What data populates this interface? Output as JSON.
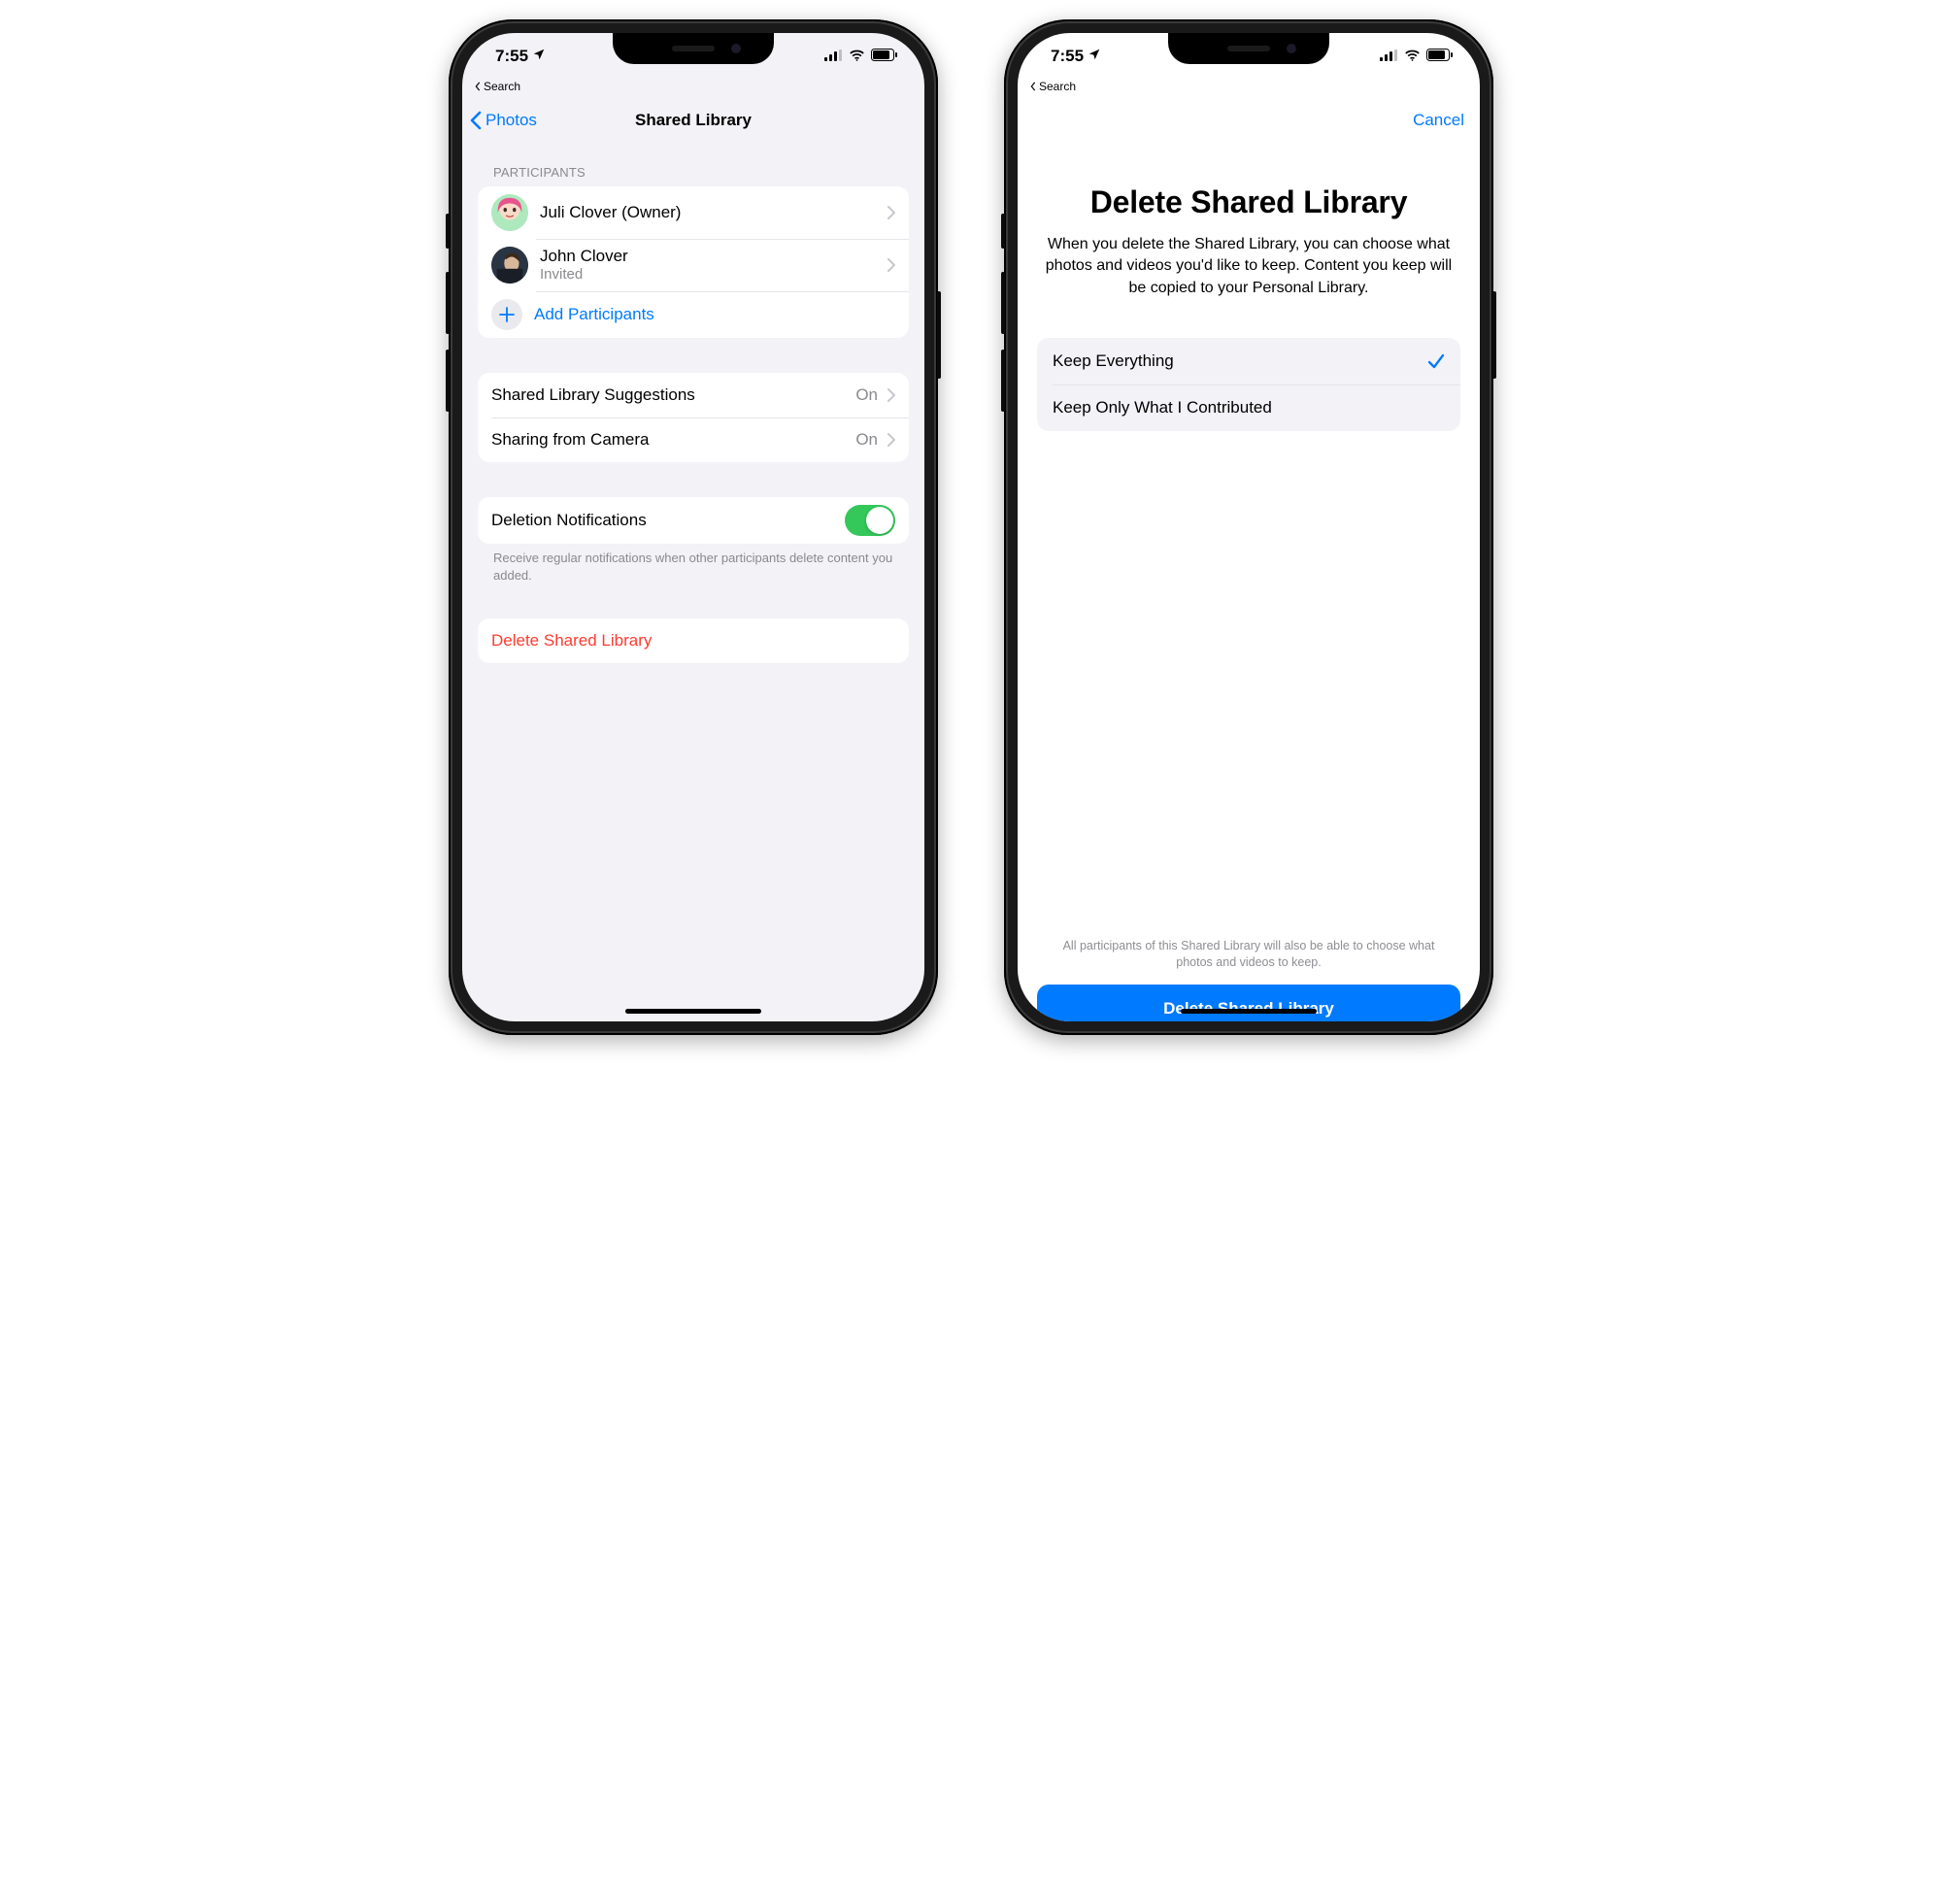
{
  "status": {
    "time": "7:55",
    "breadcrumb": "Search"
  },
  "left": {
    "nav": {
      "back": "Photos",
      "title": "Shared Library"
    },
    "participants_header": "Participants",
    "participants": [
      {
        "name": "Juli Clover (Owner)",
        "sub": ""
      },
      {
        "name": "John Clover",
        "sub": "Invited"
      }
    ],
    "add_participants": "Add Participants",
    "rows": {
      "suggestions_label": "Shared Library Suggestions",
      "suggestions_value": "On",
      "camera_label": "Sharing from Camera",
      "camera_value": "On",
      "deletion_label": "Deletion Notifications",
      "deletion_footer": "Receive regular notifications when other participants delete content you added.",
      "delete_action": "Delete Shared Library"
    }
  },
  "right": {
    "cancel": "Cancel",
    "title": "Delete Shared Library",
    "body": "When you delete the Shared Library, you can choose what photos and videos you'd like to keep. Content you keep will be copied to your Personal Library.",
    "options": [
      {
        "label": "Keep Everything",
        "selected": true
      },
      {
        "label": "Keep Only What I Contributed",
        "selected": false
      }
    ],
    "footer": "All participants of this Shared Library will also be able to choose what photos and videos to keep.",
    "action": "Delete Shared Library"
  }
}
